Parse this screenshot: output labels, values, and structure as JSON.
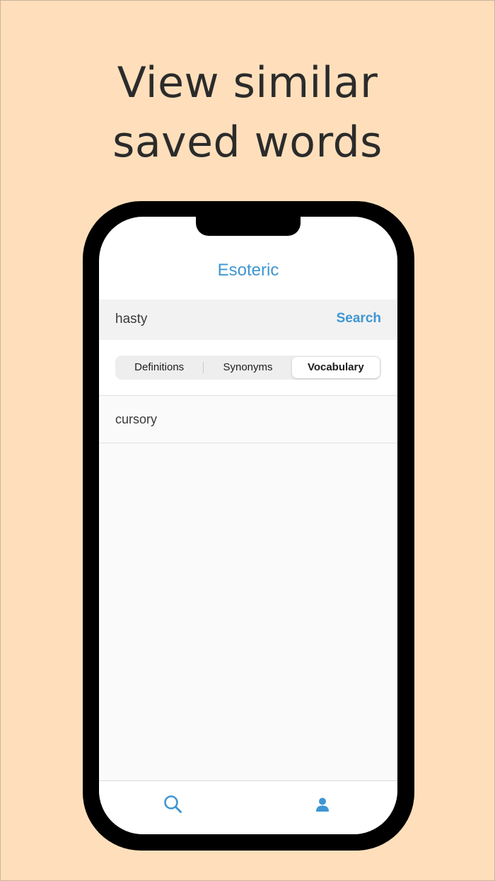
{
  "headline": {
    "line1": "View similar",
    "line2": "saved words"
  },
  "app": {
    "title": "Esoteric",
    "accent_color": "#3f96d2",
    "background_color": "#ffdfbb"
  },
  "search": {
    "value": "hasty",
    "button_label": "Search"
  },
  "segments": {
    "definitions": "Definitions",
    "synonyms": "Synonyms",
    "vocabulary": "Vocabulary",
    "selected": "Vocabulary"
  },
  "list": {
    "items": [
      "cursory"
    ]
  },
  "tab_bar": {
    "tabs": [
      {
        "icon": "search-icon"
      },
      {
        "icon": "profile-icon"
      }
    ]
  }
}
